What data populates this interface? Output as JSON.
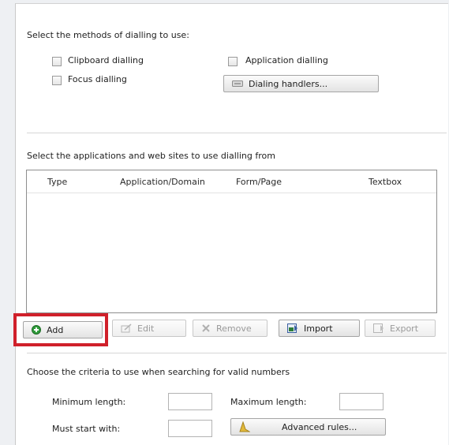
{
  "methods": {
    "heading": "Select the methods of dialling to use:",
    "clipboard": "Clipboard dialling",
    "application": "Application dialling",
    "focus": "Focus dialling",
    "handlers_button": "Dialing handlers..."
  },
  "apps": {
    "heading": "Select the applications and web sites to use dialling from",
    "columns": [
      "Type",
      "Application/Domain",
      "Form/Page",
      "Textbox"
    ],
    "rows": []
  },
  "toolbar": {
    "add": "Add",
    "edit": "Edit",
    "remove": "Remove",
    "import": "Import",
    "export": "Export"
  },
  "criteria": {
    "heading": "Choose the criteria to use when searching for valid numbers",
    "min_label": "Minimum length:",
    "max_label": "Maximum length:",
    "start_label": "Must start with:",
    "min_value": "",
    "max_value": "",
    "start_value": "",
    "advanced_button": "Advanced rules..."
  },
  "colors": {
    "highlight": "#d0202a",
    "add_icon": "#2e9b3a"
  }
}
